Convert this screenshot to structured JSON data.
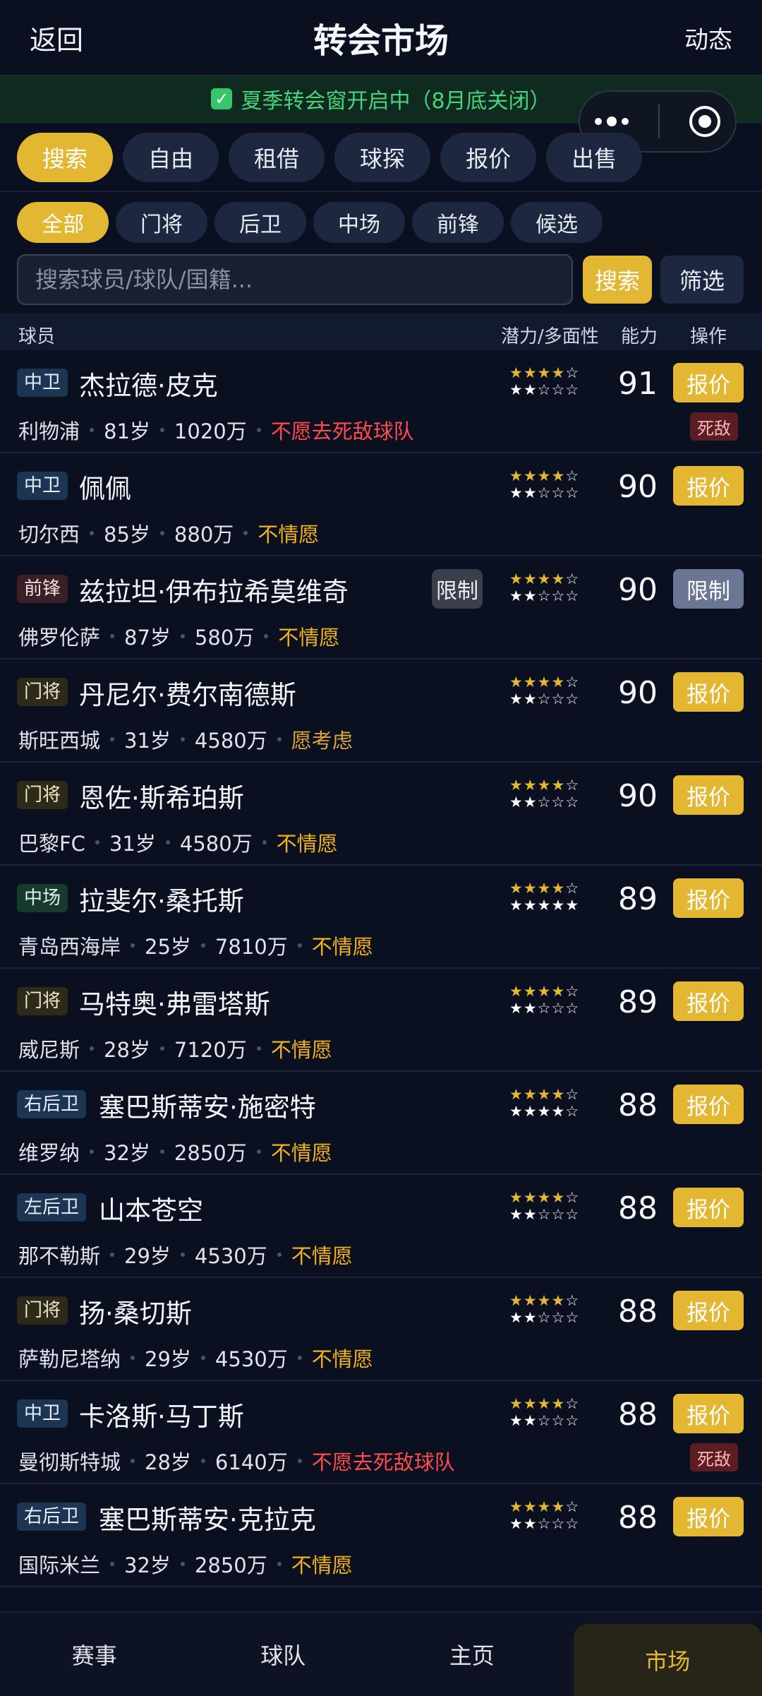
{
  "header": {
    "back": "返回",
    "title": "转会市场",
    "activity": "动态"
  },
  "banner": {
    "text": "夏季转会窗开启中（8月底关闭）"
  },
  "tabs": [
    {
      "label": "搜索",
      "active": true
    },
    {
      "label": "自由",
      "active": false
    },
    {
      "label": "租借",
      "active": false
    },
    {
      "label": "球探",
      "active": false
    },
    {
      "label": "报价",
      "active": false
    },
    {
      "label": "出售",
      "active": false
    }
  ],
  "positions": [
    {
      "label": "全部",
      "active": true
    },
    {
      "label": "门将",
      "active": false
    },
    {
      "label": "后卫",
      "active": false
    },
    {
      "label": "中场",
      "active": false
    },
    {
      "label": "前锋",
      "active": false
    },
    {
      "label": "候选",
      "active": false
    }
  ],
  "search": {
    "placeholder": "搜索球员/球队/国籍...",
    "button": "搜索",
    "filter": "筛选"
  },
  "table_header": {
    "player": "球员",
    "potential": "潜力/多面性",
    "ability": "能力",
    "action": "操作"
  },
  "players": [
    {
      "pos": "中卫",
      "pos_type": "d",
      "name": "杰拉德·皮克",
      "club": "利物浦",
      "age": "81岁",
      "value": "1020万",
      "status": "不愿去死敌球队",
      "status_type": "red",
      "potential": 4,
      "versatility": 2,
      "ability": "91",
      "action": "报价",
      "rival": "死敌"
    },
    {
      "pos": "中卫",
      "pos_type": "d",
      "name": "佩佩",
      "club": "切尔西",
      "age": "85岁",
      "value": "880万",
      "status": "不情愿",
      "status_type": "yel",
      "potential": 4,
      "versatility": 2,
      "ability": "90",
      "action": "报价"
    },
    {
      "pos": "前锋",
      "pos_type": "f",
      "name": "兹拉坦·伊布拉希莫维奇",
      "club": "佛罗伦萨",
      "age": "87岁",
      "value": "580万",
      "status": "不情愿",
      "status_type": "yel",
      "potential": 4,
      "versatility": 2,
      "ability": "90",
      "action": "限制",
      "limited": true,
      "limit_tag": "限制"
    },
    {
      "pos": "门将",
      "pos_type": "g",
      "name": "丹尼尔·费尔南德斯",
      "club": "斯旺西城",
      "age": "31岁",
      "value": "4580万",
      "status": "愿考虑",
      "status_type": "wil",
      "potential": 4,
      "versatility": 2,
      "ability": "90",
      "action": "报价"
    },
    {
      "pos": "门将",
      "pos_type": "g",
      "name": "恩佐·斯希珀斯",
      "club": "巴黎FC",
      "age": "31岁",
      "value": "4580万",
      "status": "不情愿",
      "status_type": "yel",
      "potential": 4,
      "versatility": 2,
      "ability": "90",
      "action": "报价"
    },
    {
      "pos": "中场",
      "pos_type": "m",
      "name": "拉斐尔·桑托斯",
      "club": "青岛西海岸",
      "age": "25岁",
      "value": "7810万",
      "status": "不情愿",
      "status_type": "yel",
      "potential": 4,
      "versatility": 5,
      "ability": "89",
      "action": "报价"
    },
    {
      "pos": "门将",
      "pos_type": "g",
      "name": "马特奥·弗雷塔斯",
      "club": "威尼斯",
      "age": "28岁",
      "value": "7120万",
      "status": "不情愿",
      "status_type": "yel",
      "potential": 4,
      "versatility": 2,
      "ability": "89",
      "action": "报价"
    },
    {
      "pos": "右后卫",
      "pos_type": "d",
      "name": "塞巴斯蒂安·施密特",
      "club": "维罗纳",
      "age": "32岁",
      "value": "2850万",
      "status": "不情愿",
      "status_type": "yel",
      "potential": 4,
      "versatility": 4,
      "ability": "88",
      "action": "报价"
    },
    {
      "pos": "左后卫",
      "pos_type": "d",
      "name": "山本苍空",
      "club": "那不勒斯",
      "age": "29岁",
      "value": "4530万",
      "status": "不情愿",
      "status_type": "yel",
      "potential": 4,
      "versatility": 2,
      "ability": "88",
      "action": "报价"
    },
    {
      "pos": "门将",
      "pos_type": "g",
      "name": "扬·桑切斯",
      "club": "萨勒尼塔纳",
      "age": "29岁",
      "value": "4530万",
      "status": "不情愿",
      "status_type": "yel",
      "potential": 4,
      "versatility": 2,
      "ability": "88",
      "action": "报价"
    },
    {
      "pos": "中卫",
      "pos_type": "d",
      "name": "卡洛斯·马丁斯",
      "club": "曼彻斯特城",
      "age": "28岁",
      "value": "6140万",
      "status": "不愿去死敌球队",
      "status_type": "red",
      "potential": 4,
      "versatility": 2,
      "ability": "88",
      "action": "报价",
      "rival": "死敌"
    },
    {
      "pos": "右后卫",
      "pos_type": "d",
      "name": "塞巴斯蒂安·克拉克",
      "club": "国际米兰",
      "age": "32岁",
      "value": "2850万",
      "status": "不情愿",
      "status_type": "yel",
      "potential": 4,
      "versatility": 2,
      "ability": "88",
      "action": "报价"
    }
  ],
  "nav": [
    {
      "label": "赛事",
      "active": false
    },
    {
      "label": "球队",
      "active": false
    },
    {
      "label": "主页",
      "active": false
    },
    {
      "label": "市场",
      "active": true
    }
  ]
}
